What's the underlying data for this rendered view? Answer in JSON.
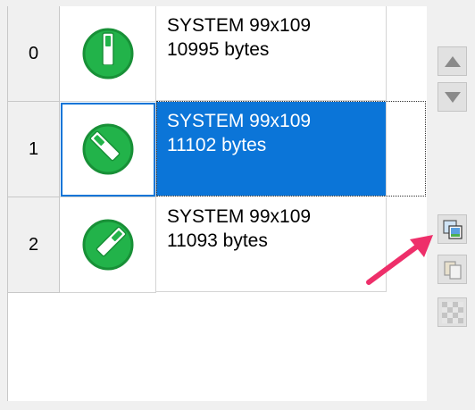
{
  "rows": [
    {
      "index": "0",
      "name": "SYSTEM 99x109",
      "size": "10995 bytes",
      "icon": "green-switch-vertical-icon",
      "selected": false
    },
    {
      "index": "1",
      "name": "SYSTEM 99x109",
      "size": "11102 bytes",
      "icon": "green-switch-diagonal-left-icon",
      "selected": true
    },
    {
      "index": "2",
      "name": "SYSTEM 99x109",
      "size": "11093 bytes",
      "icon": "green-switch-diagonal-right-icon",
      "selected": false
    }
  ],
  "side_buttons": [
    "move-up-icon",
    "move-down-icon",
    "replace-image-icon",
    "copy-image-icon",
    "transparency-icon"
  ],
  "colors": {
    "selection": "#0b75d8",
    "icon_green": "#22b34a",
    "annotation_arrow": "#ee2f6a"
  }
}
